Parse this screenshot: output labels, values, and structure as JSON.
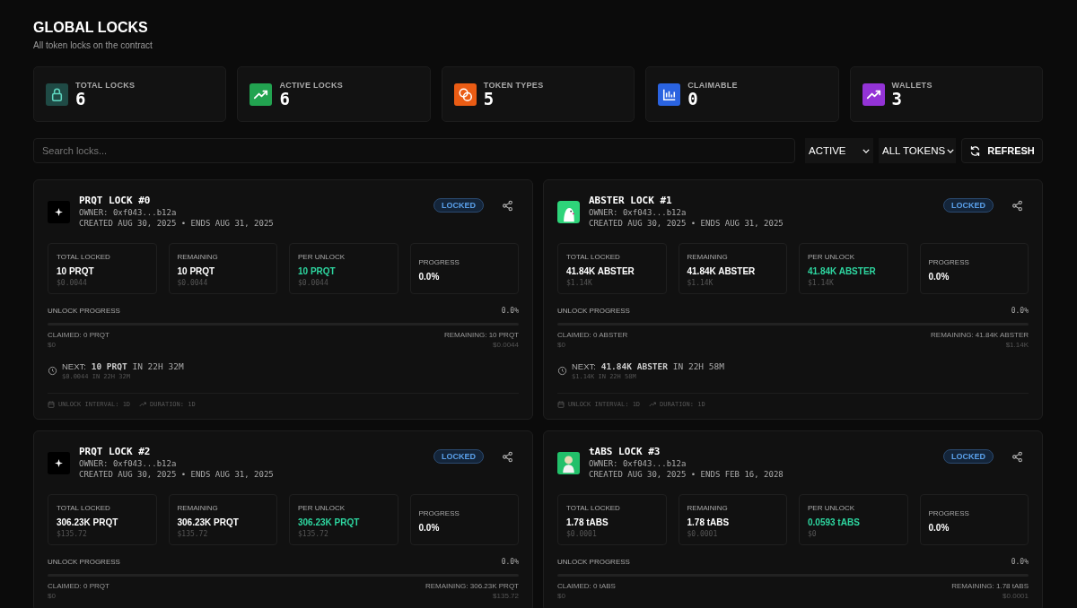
{
  "header": {
    "title": "GLOBAL LOCKS",
    "subtitle": "All token locks on the contract"
  },
  "stats": [
    {
      "label": "TOTAL LOCKS",
      "value": "6",
      "kind": "lock",
      "color": "#1f4a45"
    },
    {
      "label": "ACTIVE LOCKS",
      "value": "6",
      "kind": "trend",
      "color": "#22a350"
    },
    {
      "label": "TOKEN TYPES",
      "value": "5",
      "kind": "coins",
      "color": "#ea5c14"
    },
    {
      "label": "CLAIMABLE",
      "value": "0",
      "kind": "chart",
      "color": "#2a63e0"
    },
    {
      "label": "WALLETS",
      "value": "3",
      "kind": "trend",
      "color": "#9333d6"
    }
  ],
  "toolbar": {
    "search": {
      "placeholder": "Search locks..."
    },
    "status_filter": "ACTIVE",
    "token_filter": "ALL TOKENS",
    "refresh": "REFRESH"
  },
  "locks": [
    {
      "title": "PRQT LOCK #0",
      "kind": "star",
      "owner": "OWNER: 0xf043...b12a",
      "dates": "CREATED AUG 30, 2025 • ENDS AUG 31, 2025",
      "status": "LOCKED",
      "metrics": [
        {
          "label": "TOTAL LOCKED",
          "value": "10 PRQT",
          "usd": "$0.0044",
          "kind": "plain"
        },
        {
          "label": "REMAINING",
          "value": "10 PRQT",
          "usd": "$0.0044",
          "kind": "plain"
        },
        {
          "label": "PER UNLOCK",
          "value": "10 PRQT",
          "usd": "$0.0044",
          "kind": "accent"
        },
        {
          "label": "PROGRESS",
          "value": "0.0%",
          "kind": "plain"
        }
      ],
      "progress": {
        "label": "UNLOCK PROGRESS",
        "reading": "0.0%",
        "level": 0
      },
      "claimed": "CLAIMED: 0 PRQT",
      "claimed_usd": "$0",
      "remaining": "REMAINING: 10 PRQT",
      "remaining_usd": "$0.0044",
      "next": {
        "label": "NEXT:",
        "amount": "10 PRQT",
        "when": "IN 22H 32M",
        "detail": "$0.0044 IN 22H 32M"
      },
      "interval": "UNLOCK INTERVAL: 1D",
      "duration": "DURATION: 1D"
    },
    {
      "title": "ABSTER LOCK #1",
      "kind": "penguin",
      "owner": "OWNER: 0xf043...b12a",
      "dates": "CREATED AUG 30, 2025 • ENDS AUG 31, 2025",
      "status": "LOCKED",
      "metrics": [
        {
          "label": "TOTAL LOCKED",
          "value": "41.84K ABSTER",
          "usd": "$1.14K",
          "kind": "plain"
        },
        {
          "label": "REMAINING",
          "value": "41.84K ABSTER",
          "usd": "$1.14K",
          "kind": "plain"
        },
        {
          "label": "PER UNLOCK",
          "value": "41.84K ABSTER",
          "usd": "$1.14K",
          "kind": "accent"
        },
        {
          "label": "PROGRESS",
          "value": "0.0%",
          "kind": "plain"
        }
      ],
      "progress": {
        "label": "UNLOCK PROGRESS",
        "reading": "0.0%",
        "level": 0
      },
      "claimed": "CLAIMED: 0 ABSTER",
      "claimed_usd": "$0",
      "remaining": "REMAINING: 41.84K ABSTER",
      "remaining_usd": "$1.14K",
      "next": {
        "label": "NEXT:",
        "amount": "41.84K ABSTER",
        "when": "IN 22H 58M",
        "detail": "$1.14K IN 22H 58M"
      },
      "interval": "UNLOCK INTERVAL: 1D",
      "duration": "DURATION: 1D"
    },
    {
      "title": "PRQT LOCK #2",
      "kind": "star",
      "owner": "OWNER: 0xf043...b12a",
      "dates": "CREATED AUG 30, 2025 • ENDS AUG 31, 2025",
      "status": "LOCKED",
      "metrics": [
        {
          "label": "TOTAL LOCKED",
          "value": "306.23K PRQT",
          "usd": "$135.72",
          "kind": "plain"
        },
        {
          "label": "REMAINING",
          "value": "306.23K PRQT",
          "usd": "$135.72",
          "kind": "plain"
        },
        {
          "label": "PER UNLOCK",
          "value": "306.23K PRQT",
          "usd": "$135.72",
          "kind": "accent"
        },
        {
          "label": "PROGRESS",
          "value": "0.0%",
          "kind": "plain"
        }
      ],
      "progress": {
        "label": "UNLOCK PROGRESS",
        "reading": "0.0%",
        "level": 0
      },
      "claimed": "CLAIMED: 0 PRQT",
      "claimed_usd": "$0",
      "remaining": "REMAINING: 306.23K PRQT",
      "remaining_usd": "$135.72"
    },
    {
      "title": "tABS LOCK #3",
      "kind": "figure",
      "owner": "OWNER: 0xf043...b12a",
      "dates": "CREATED AUG 30, 2025 • ENDS FEB 16, 2028",
      "status": "LOCKED",
      "metrics": [
        {
          "label": "TOTAL LOCKED",
          "value": "1.78 tABS",
          "usd": "$0.0001",
          "kind": "plain"
        },
        {
          "label": "REMAINING",
          "value": "1.78 tABS",
          "usd": "$0.0001",
          "kind": "plain"
        },
        {
          "label": "PER UNLOCK",
          "value": "0.0593 tABS",
          "usd": "$0",
          "kind": "accent"
        },
        {
          "label": "PROGRESS",
          "value": "0.0%",
          "kind": "plain"
        }
      ],
      "progress": {
        "label": "UNLOCK PROGRESS",
        "reading": "0.0%",
        "level": 0
      },
      "claimed": "CLAIMED: 0 tABS",
      "claimed_usd": "$0",
      "remaining": "REMAINING: 1.78 tABS",
      "remaining_usd": "$0.0001"
    }
  ]
}
